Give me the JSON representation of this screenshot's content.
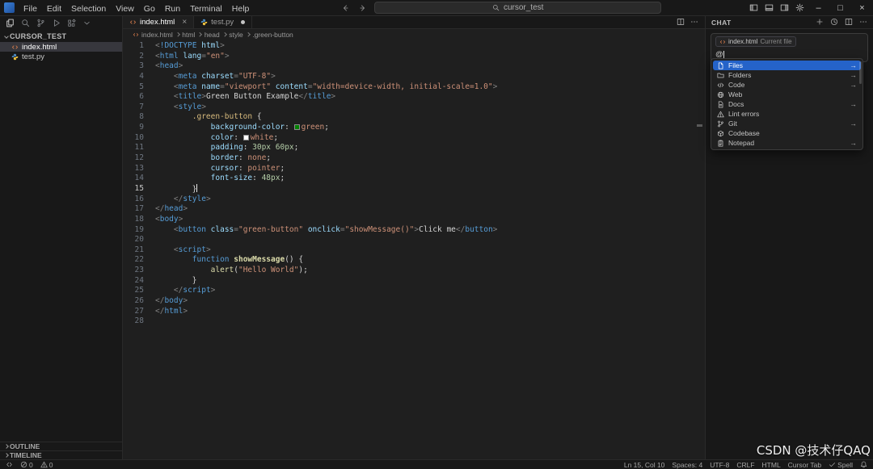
{
  "titlebar": {
    "menus": [
      "File",
      "Edit",
      "Selection",
      "View",
      "Go",
      "Run",
      "Terminal",
      "Help"
    ],
    "search_text": "cursor_test",
    "right_icons": [
      "panel-left",
      "panel-bottom",
      "panel-right",
      "gear"
    ],
    "window_controls": [
      {
        "name": "minimize",
        "glyph": "–"
      },
      {
        "name": "maximize",
        "glyph": "□"
      },
      {
        "name": "close",
        "glyph": "×"
      }
    ]
  },
  "sidebar": {
    "activity": [
      {
        "icon": "files",
        "active": true
      },
      {
        "icon": "search",
        "active": false
      },
      {
        "icon": "branch",
        "active": false
      },
      {
        "icon": "debug",
        "active": false
      },
      {
        "icon": "extensions",
        "active": false
      },
      {
        "icon": "chevron-down",
        "active": false
      }
    ],
    "explorer_title": "CURSOR_TEST",
    "files": [
      {
        "name": "index.html",
        "icon": "html",
        "selected": true
      },
      {
        "name": "test.py",
        "icon": "python",
        "selected": false
      }
    ],
    "bottom_sections": [
      "OUTLINE",
      "TIMELINE"
    ]
  },
  "tabs": [
    {
      "label": "index.html",
      "icon": "html",
      "active": true,
      "modified": false
    },
    {
      "label": "test.py",
      "icon": "python",
      "active": false,
      "modified": true
    }
  ],
  "editor_actions": [
    "split",
    "ellipsis"
  ],
  "breadcrumb": [
    "index.html",
    "html",
    "head",
    "style",
    ".green-button"
  ],
  "editor": {
    "active_line": 15,
    "cursor_position": "Ln 15, Col 10",
    "lines": [
      [
        [
          "<",
          "p"
        ],
        [
          "!DOCTYPE",
          "tag"
        ],
        [
          " html",
          "attr"
        ],
        [
          ">",
          "p"
        ]
      ],
      [
        [
          "<",
          "p"
        ],
        [
          "html",
          "tag"
        ],
        [
          " lang",
          "attr"
        ],
        [
          "=",
          "p"
        ],
        [
          "\"en\"",
          "str"
        ],
        [
          ">",
          "p"
        ]
      ],
      [
        [
          "<",
          "p"
        ],
        [
          "head",
          "tag"
        ],
        [
          ">",
          "p"
        ]
      ],
      [
        [
          "    ",
          "txt"
        ],
        [
          "<",
          "p"
        ],
        [
          "meta",
          "tag"
        ],
        [
          " charset",
          "attr"
        ],
        [
          "=",
          "p"
        ],
        [
          "\"UTF-8\"",
          "str"
        ],
        [
          ">",
          "p"
        ]
      ],
      [
        [
          "    ",
          "txt"
        ],
        [
          "<",
          "p"
        ],
        [
          "meta",
          "tag"
        ],
        [
          " name",
          "attr"
        ],
        [
          "=",
          "p"
        ],
        [
          "\"viewport\"",
          "str"
        ],
        [
          " content",
          "attr"
        ],
        [
          "=",
          "p"
        ],
        [
          "\"width=device-width, initial-scale=1.0\"",
          "str"
        ],
        [
          ">",
          "p"
        ]
      ],
      [
        [
          "    ",
          "txt"
        ],
        [
          "<",
          "p"
        ],
        [
          "title",
          "tag"
        ],
        [
          ">",
          "p"
        ],
        [
          "Green Button Example",
          "txt"
        ],
        [
          "</",
          "p"
        ],
        [
          "title",
          "tag"
        ],
        [
          ">",
          "p"
        ]
      ],
      [
        [
          "    ",
          "txt"
        ],
        [
          "<",
          "p"
        ],
        [
          "style",
          "tag"
        ],
        [
          ">",
          "p"
        ]
      ],
      [
        [
          "        ",
          "txt"
        ],
        [
          ".green-button",
          "sel"
        ],
        [
          " {",
          "txt"
        ]
      ],
      [
        [
          "            ",
          "txt"
        ],
        [
          "background-color",
          "attr"
        ],
        [
          ": ",
          "txt"
        ],
        [
          "#008000",
          "swatch"
        ],
        [
          "green",
          "str"
        ],
        [
          ";",
          "txt"
        ]
      ],
      [
        [
          "            ",
          "txt"
        ],
        [
          "color",
          "attr"
        ],
        [
          ": ",
          "txt"
        ],
        [
          "#ffffff",
          "swatch"
        ],
        [
          "white",
          "str"
        ],
        [
          ";",
          "txt"
        ]
      ],
      [
        [
          "            ",
          "txt"
        ],
        [
          "padding",
          "attr"
        ],
        [
          ": ",
          "txt"
        ],
        [
          "30px",
          "num"
        ],
        [
          " ",
          "txt"
        ],
        [
          "60px",
          "num"
        ],
        [
          ";",
          "txt"
        ]
      ],
      [
        [
          "            ",
          "txt"
        ],
        [
          "border",
          "attr"
        ],
        [
          ": ",
          "txt"
        ],
        [
          "none",
          "str"
        ],
        [
          ";",
          "txt"
        ]
      ],
      [
        [
          "            ",
          "txt"
        ],
        [
          "cursor",
          "attr"
        ],
        [
          ": ",
          "txt"
        ],
        [
          "pointer",
          "str"
        ],
        [
          ";",
          "txt"
        ]
      ],
      [
        [
          "            ",
          "txt"
        ],
        [
          "font-size",
          "attr"
        ],
        [
          ": ",
          "txt"
        ],
        [
          "48px",
          "num"
        ],
        [
          ";",
          "txt"
        ]
      ],
      [
        [
          "        }",
          "txt"
        ]
      ],
      [
        [
          "    ",
          "txt"
        ],
        [
          "</",
          "p"
        ],
        [
          "style",
          "tag"
        ],
        [
          ">",
          "p"
        ]
      ],
      [
        [
          "</",
          "p"
        ],
        [
          "head",
          "tag"
        ],
        [
          ">",
          "p"
        ]
      ],
      [
        [
          "<",
          "p"
        ],
        [
          "body",
          "tag"
        ],
        [
          ">",
          "p"
        ]
      ],
      [
        [
          "    ",
          "txt"
        ],
        [
          "<",
          "p"
        ],
        [
          "button",
          "tag"
        ],
        [
          " class",
          "attr"
        ],
        [
          "=",
          "p"
        ],
        [
          "\"green-button\"",
          "str"
        ],
        [
          " onclick",
          "attr"
        ],
        [
          "=",
          "p"
        ],
        [
          "\"showMessage()\"",
          "str"
        ],
        [
          ">",
          "p"
        ],
        [
          "Click me",
          "txt"
        ],
        [
          "</",
          "p"
        ],
        [
          "button",
          "tag"
        ],
        [
          ">",
          "p"
        ]
      ],
      [],
      [
        [
          "    ",
          "txt"
        ],
        [
          "<",
          "p"
        ],
        [
          "script",
          "tag"
        ],
        [
          ">",
          "p"
        ]
      ],
      [
        [
          "        ",
          "txt"
        ],
        [
          "function",
          "kw"
        ],
        [
          " ",
          "txt"
        ],
        [
          "showMessage",
          "fnb"
        ],
        [
          "() {",
          "txt"
        ]
      ],
      [
        [
          "            ",
          "txt"
        ],
        [
          "alert",
          "fn"
        ],
        [
          "(",
          "txt"
        ],
        [
          "\"Hello World\"",
          "str"
        ],
        [
          ");",
          "txt"
        ]
      ],
      [
        [
          "        }",
          "txt"
        ]
      ],
      [
        [
          "    ",
          "txt"
        ],
        [
          "</",
          "p"
        ],
        [
          "script",
          "tag"
        ],
        [
          ">",
          "p"
        ]
      ],
      [
        [
          "</",
          "p"
        ],
        [
          "body",
          "tag"
        ],
        [
          ">",
          "p"
        ]
      ],
      [
        [
          "</",
          "p"
        ],
        [
          "html",
          "tag"
        ],
        [
          ">",
          "p"
        ]
      ],
      []
    ]
  },
  "chat": {
    "title": "CHAT",
    "header_icons": [
      "plus",
      "history",
      "split",
      "ellipsis"
    ],
    "context_chip": {
      "icon": "html",
      "file": "index.html",
      "label": "Current file"
    },
    "input_value": "@",
    "selection_color": "#2563c9",
    "dropdown": [
      {
        "icon": "file",
        "label": "Files",
        "arrow": "→",
        "selected": true
      },
      {
        "icon": "folder",
        "label": "Folders",
        "arrow": "→",
        "selected": false
      },
      {
        "icon": "code",
        "label": "Code",
        "arrow": "→",
        "selected": false
      },
      {
        "icon": "globe",
        "label": "Web",
        "arrow": "",
        "selected": false
      },
      {
        "icon": "docs",
        "label": "Docs",
        "arrow": "→",
        "selected": false
      },
      {
        "icon": "warning",
        "label": "Lint errors",
        "arrow": "",
        "selected": false
      },
      {
        "icon": "branch",
        "label": "Git",
        "arrow": "→",
        "selected": false
      },
      {
        "icon": "codebase",
        "label": "Codebase",
        "arrow": "",
        "selected": false
      },
      {
        "icon": "notepad",
        "label": "Notepad",
        "arrow": "→",
        "selected": false
      }
    ]
  },
  "statusbar": {
    "left": [
      {
        "icon": "remote",
        "label": ""
      },
      {
        "icon": "error",
        "label": "0"
      },
      {
        "icon": "warning",
        "label": "0"
      }
    ],
    "right": [
      {
        "icon": "",
        "label": "Ln 15, Col 10"
      },
      {
        "icon": "",
        "label": "Spaces: 4"
      },
      {
        "icon": "",
        "label": "UTF-8"
      },
      {
        "icon": "",
        "label": "CRLF"
      },
      {
        "icon": "",
        "label": "HTML"
      },
      {
        "icon": "",
        "label": "Cursor Tab"
      },
      {
        "icon": "check",
        "label": "Spell"
      },
      {
        "icon": "bell",
        "label": ""
      }
    ]
  },
  "watermark": {
    "text": "CSDN @技术仔QAQ"
  }
}
